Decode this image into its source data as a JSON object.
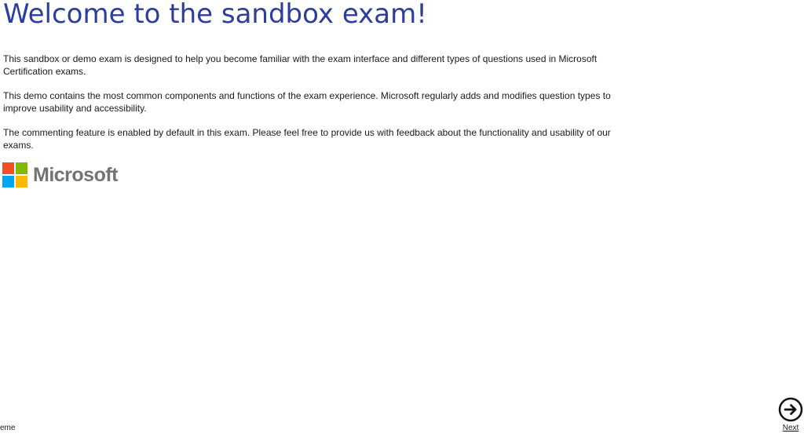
{
  "header": {
    "title": "Welcome to the sandbox exam!"
  },
  "content": {
    "paragraphs": [
      "This sandbox or demo exam is designed to help you become familiar with the exam interface and different types of questions used in Microsoft Certification exams.",
      "This demo contains the most common components and functions of the exam experience. Microsoft regularly adds and modifies question types to improve usability and accessibility.",
      "The commenting feature is enabled by default in this exam. Please feel free to provide us with feedback about the functionality and usability of our exams."
    ]
  },
  "logo": {
    "text": "Microsoft",
    "colors": [
      "#f25022",
      "#7fba00",
      "#00a4ef",
      "#ffb900"
    ]
  },
  "footer": {
    "theme_label": "eme",
    "next_label": "Next",
    "next_icon": "arrow-circle-right-icon"
  },
  "colors": {
    "title": "#2b3d9e",
    "text": "#1a1a1a"
  }
}
